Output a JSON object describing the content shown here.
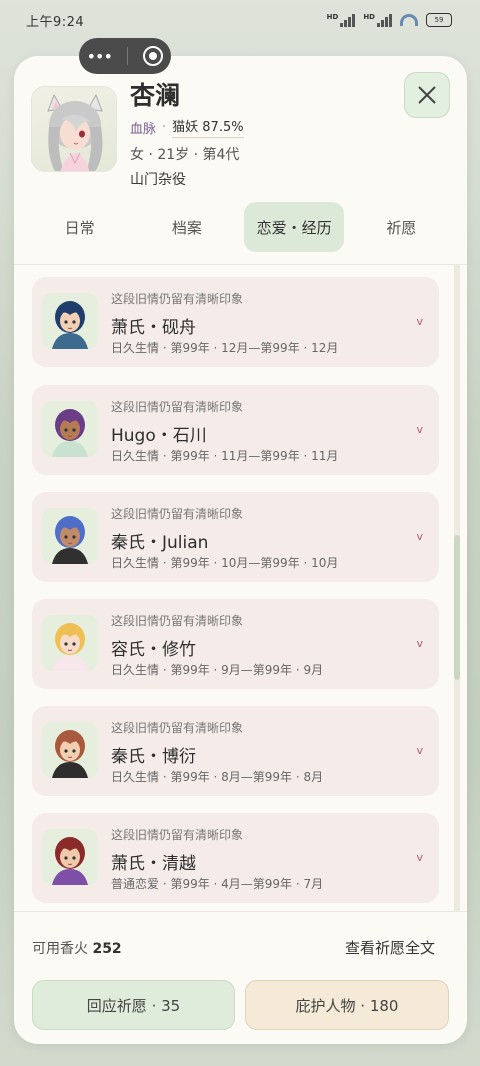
{
  "status": {
    "time": "上午9:24",
    "battery": "59"
  },
  "character": {
    "name": "杏澜",
    "bloodline_label": "血脉",
    "bloodline_value": "猫妖 87.5%",
    "meta": "女 · 21岁 · 第4代",
    "role": "山门杂役"
  },
  "tabs": [
    {
      "label": "日常",
      "active": false
    },
    {
      "label": "档案",
      "active": false
    },
    {
      "label": "恋爱・经历",
      "active": true
    },
    {
      "label": "祈愿",
      "active": false
    }
  ],
  "entries": [
    {
      "note": "这段旧情仍留有清晰印象",
      "name": "萧氏・砚舟",
      "dates": "日久生情 · 第99年 · 12月—第99年 · 12月",
      "hair": "#1f3e6b",
      "skin": "#f1d0b4",
      "shirt": "#3d6b8f"
    },
    {
      "note": "这段旧情仍留有清晰印象",
      "name": "Hugo・石川",
      "dates": "日久生情 · 第99年 · 11月—第99年 · 11月",
      "hair": "#6a3d86",
      "skin": "#b57b55",
      "shirt": "#c9e2d0"
    },
    {
      "note": "这段旧情仍留有清晰印象",
      "name": "秦氏・Julian",
      "dates": "日久生情 · 第99年 · 10月—第99年 · 10月",
      "hair": "#4f6ec7",
      "skin": "#c18a68",
      "shirt": "#303030"
    },
    {
      "note": "这段旧情仍留有清晰印象",
      "name": "容氏・修竹",
      "dates": "日久生情 · 第99年 · 9月—第99年 · 9月",
      "hair": "#efbf54",
      "skin": "#f6dcc6",
      "shirt": "#f7e6ec"
    },
    {
      "note": "这段旧情仍留有清晰印象",
      "name": "秦氏・博衍",
      "dates": "日久生情 · 第99年 · 8月—第99年 · 8月",
      "hair": "#a9593e",
      "skin": "#f3cfb1",
      "shirt": "#2e2e2e"
    },
    {
      "note": "这段旧情仍留有清晰印象",
      "name": "萧氏・清越",
      "dates": "普通恋爱 · 第99年 · 4月—第99年 · 7月",
      "hair": "#8a2a2a",
      "skin": "#f0c9aa",
      "shirt": "#7d4fa6"
    }
  ],
  "footer": {
    "incense_label": "可用香火",
    "incense_value": "252",
    "view_all": "查看祈愿全文",
    "respond_button": "回应祈愿 · 35",
    "protect_button": "庇护人物 · 180"
  }
}
